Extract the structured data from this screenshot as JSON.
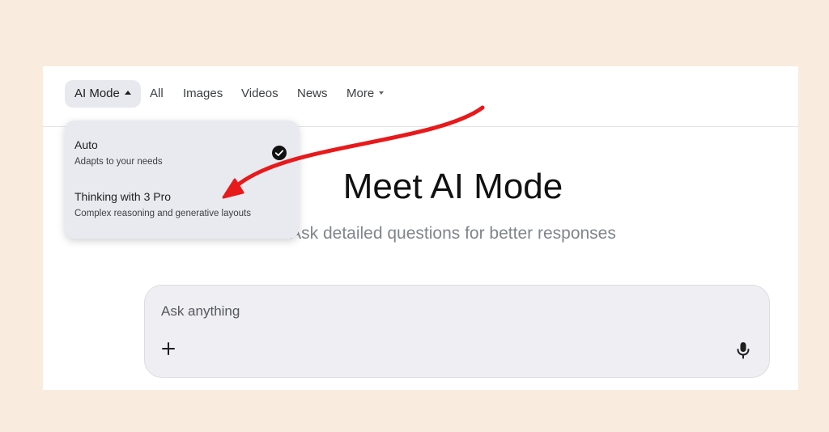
{
  "tabs": {
    "ai_mode": "AI Mode",
    "all": "All",
    "images": "Images",
    "videos": "Videos",
    "news": "News",
    "more": "More"
  },
  "main": {
    "title": "Meet AI Mode",
    "subtitle": "Ask detailed questions for better responses"
  },
  "ask": {
    "placeholder": "Ask anything",
    "plus_icon": "plus-icon",
    "mic_icon": "mic-icon"
  },
  "dropdown": {
    "options": [
      {
        "title": "Auto",
        "description": "Adapts to your needs",
        "selected": true
      },
      {
        "title": "Thinking with 3 Pro",
        "description": "Complex reasoning and generative layouts",
        "selected": false
      }
    ]
  },
  "colors": {
    "background": "#f9ebde",
    "annotation_arrow": "#e8191b",
    "dropdown_bg": "#e9eaf0",
    "askbox_bg": "#eeeef3"
  }
}
